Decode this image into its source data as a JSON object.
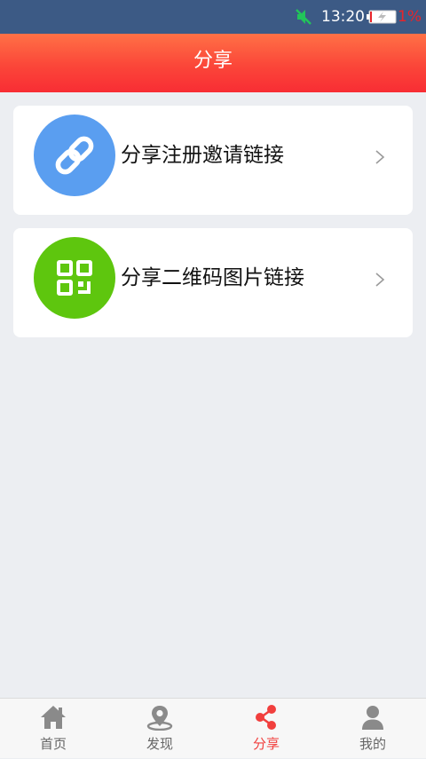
{
  "status_bar": {
    "time": "13:20",
    "battery_percent": "1%",
    "icons": [
      "mute-icon",
      "battery-charging-icon"
    ]
  },
  "header": {
    "title": "分享"
  },
  "share_options": [
    {
      "label": "分享注册邀请链接",
      "icon": "link-icon",
      "color": "#5a9ef0"
    },
    {
      "label": "分享二维码图片链接",
      "icon": "qr-code-icon",
      "color": "#5ec60e"
    }
  ],
  "tab_bar": {
    "active_color": "#f13f3d",
    "items": [
      {
        "label": "首页",
        "icon": "home-icon",
        "active": false
      },
      {
        "label": "发现",
        "icon": "location-pin-icon",
        "active": false
      },
      {
        "label": "分享",
        "icon": "share-icon",
        "active": true
      },
      {
        "label": "我的",
        "icon": "user-icon",
        "active": false
      }
    ]
  }
}
